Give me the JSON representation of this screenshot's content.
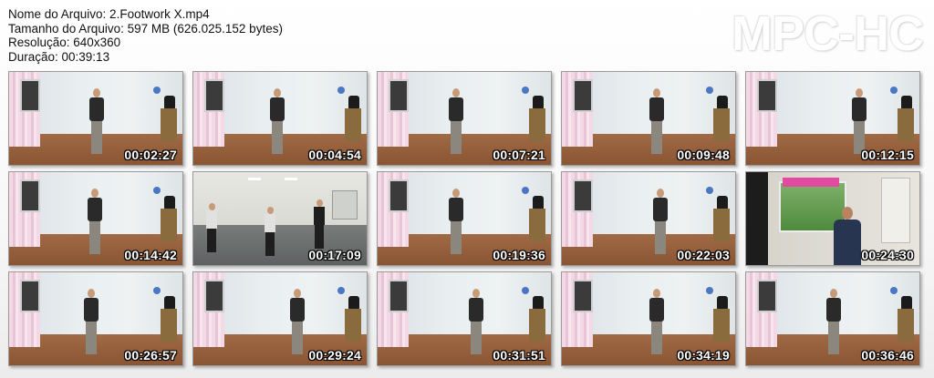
{
  "info": {
    "filename_line": "Nome do Arquivo: 2.Footwork X.mp4",
    "filesize_line": "Tamanho do Arquivo: 597 MB (626.025.152 bytes)",
    "resolution_line": "Resolução: 640x360",
    "duration_line": "Duração: 00:39:13"
  },
  "logo": "MPC-HC",
  "thumbnails": [
    {
      "time": "00:02:27",
      "scene": "room"
    },
    {
      "time": "00:04:54",
      "scene": "room"
    },
    {
      "time": "00:07:21",
      "scene": "room"
    },
    {
      "time": "00:09:48",
      "scene": "room"
    },
    {
      "time": "00:12:15",
      "scene": "room"
    },
    {
      "time": "00:14:42",
      "scene": "room"
    },
    {
      "time": "00:17:09",
      "scene": "gym"
    },
    {
      "time": "00:19:36",
      "scene": "room"
    },
    {
      "time": "00:22:03",
      "scene": "room"
    },
    {
      "time": "00:24:30",
      "scene": "webcam"
    },
    {
      "time": "00:26:57",
      "scene": "room"
    },
    {
      "time": "00:29:24",
      "scene": "room"
    },
    {
      "time": "00:31:51",
      "scene": "room"
    },
    {
      "time": "00:34:19",
      "scene": "room"
    },
    {
      "time": "00:36:46",
      "scene": "room"
    }
  ]
}
